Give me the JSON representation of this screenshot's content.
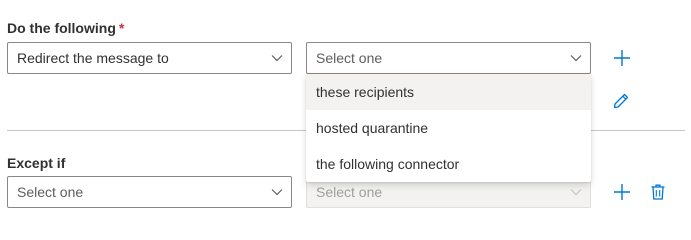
{
  "action_section": {
    "label": "Do the following",
    "required_marker": "*",
    "action_select": {
      "value": "Redirect the message to"
    },
    "target_select": {
      "placeholder": "Select one"
    },
    "dropdown_options": [
      {
        "label": "these recipients",
        "hovered": true
      },
      {
        "label": "hosted quarantine"
      },
      {
        "label": "the following connector"
      }
    ]
  },
  "exception_section": {
    "label": "Except if",
    "condition_select": {
      "placeholder": "Select one"
    },
    "target_select": {
      "placeholder": "Select one",
      "disabled": true
    }
  },
  "icons": {
    "add": "plus-icon",
    "edit": "pencil-icon",
    "delete": "trash-icon",
    "dropdown": "chevron-down-icon"
  },
  "colors": {
    "accent": "#0078d4",
    "required": "#c4314b",
    "hover_bg": "#f3f2f1",
    "divider": "#c8c6c4"
  }
}
